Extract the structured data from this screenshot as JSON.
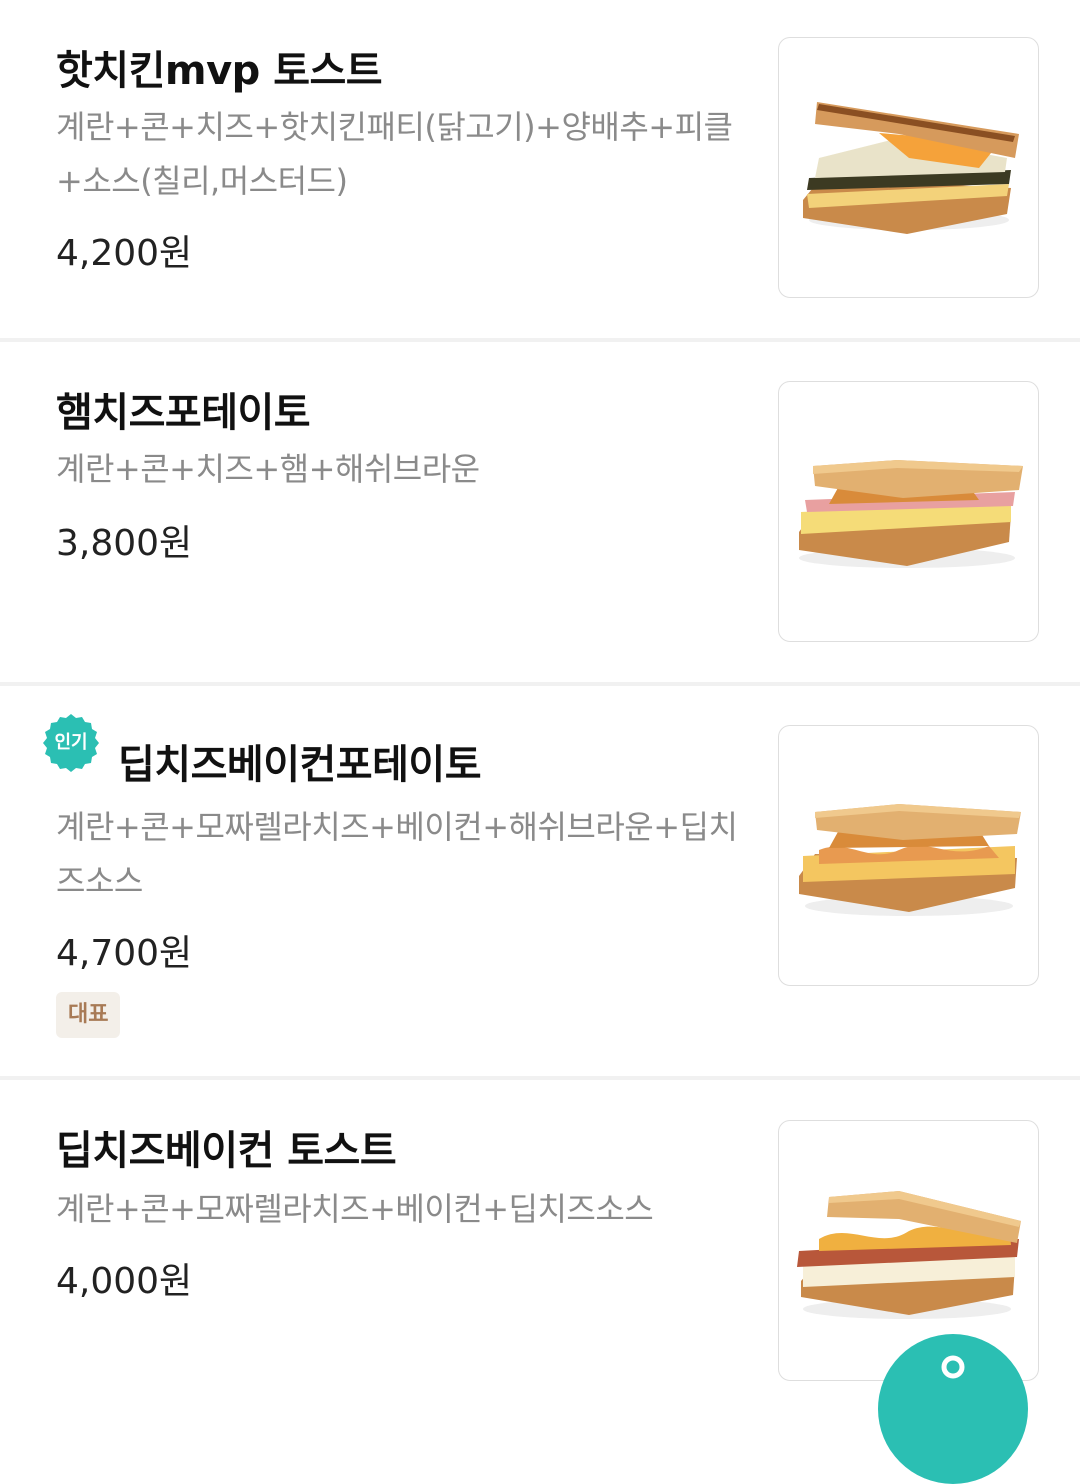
{
  "items": [
    {
      "title": "핫치킨mvp 토스트",
      "desc": "계란+콘+치즈+핫치킨패티(닭고기)+양배추+피클+소스(칠리,머스터드)",
      "price": "4,200원",
      "image": "sandwich-hot-chicken"
    },
    {
      "title": "햄치즈포테이토",
      "desc": "계란+콘+치즈+햄+해쉬브라운",
      "price": "3,800원",
      "image": "sandwich-ham-cheese"
    },
    {
      "title": "딥치즈베이컨포테이토",
      "badge": "인기",
      "desc": "계란+콘+모짜렐라치즈+베이컨+해쉬브라운+딥치즈소스",
      "price": "4,700원",
      "tag": "대표",
      "image": "sandwich-deep-cheese-bacon-potato"
    },
    {
      "title": "딥치즈베이컨 토스트",
      "desc": "계란+콘+모짜렐라치즈+베이컨+딥치즈소스",
      "price": "4,000원",
      "image": "sandwich-deep-cheese-bacon"
    }
  ],
  "colors": {
    "accent": "#2bbfb3",
    "tag_bg": "#f3efe9",
    "tag_text": "#a87a55",
    "desc": "#8a8a8a"
  },
  "fab": {
    "icon": "person-icon"
  }
}
